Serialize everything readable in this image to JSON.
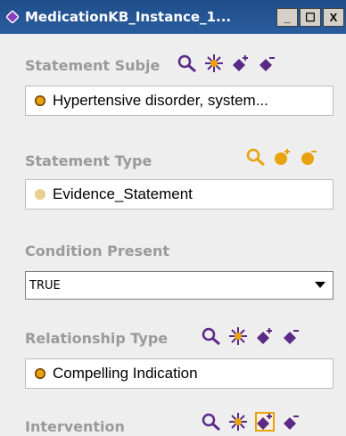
{
  "window": {
    "title": "MedicationKB_Instance_1...",
    "minimize": "_",
    "maximize": "☐",
    "close": "X"
  },
  "statement_subject": {
    "label": "Statement Subje",
    "value": "Hypertensive disorder, system..."
  },
  "statement_type": {
    "label": "Statement Type",
    "value": "Evidence_Statement"
  },
  "condition_present": {
    "label": "Condition Present",
    "value": "TRUE"
  },
  "relationship_type": {
    "label": "Relationship Type",
    "value": "Compelling Indication"
  },
  "intervention": {
    "label": "Intervention"
  },
  "colors": {
    "title_bar": "#2b5d9e",
    "label_gray": "#9a9a9a",
    "tool_purple": "#5a2a86",
    "tool_orange": "#e8a30c",
    "instance_dot": "#e8a30c",
    "class_dot": "#e9cf8f"
  }
}
